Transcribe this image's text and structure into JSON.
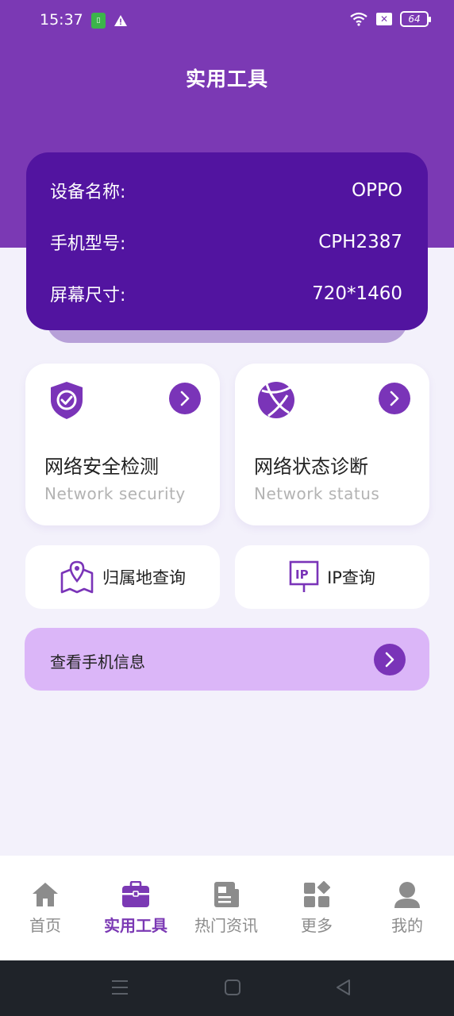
{
  "status_bar": {
    "time": "15:37",
    "battery": "64",
    "icons": [
      "sim-icon",
      "warning-icon",
      "wifi-icon",
      "no-sim-icon",
      "battery-icon"
    ]
  },
  "header": {
    "title": "实用工具"
  },
  "device_info": {
    "rows": [
      {
        "label": "设备名称:",
        "value": "OPPO"
      },
      {
        "label": "手机型号:",
        "value": "CPH2387"
      },
      {
        "label": "屏幕尺寸:",
        "value": "720*1460"
      }
    ]
  },
  "tools": [
    {
      "title": "网络安全检测",
      "subtitle": "Network security",
      "icon": "shield-check-icon"
    },
    {
      "title": "网络状态诊断",
      "subtitle": "Network status",
      "icon": "globe-icon"
    }
  ],
  "quick_tools": [
    {
      "label": "归属地查询",
      "icon": "map-pin-icon"
    },
    {
      "label": "IP查询",
      "icon": "ip-icon"
    }
  ],
  "phone_info": {
    "label": "查看手机信息"
  },
  "bottom_nav": {
    "items": [
      {
        "label": "首页",
        "icon": "home-icon",
        "active": false
      },
      {
        "label": "实用工具",
        "icon": "toolbox-icon",
        "active": true
      },
      {
        "label": "热门资讯",
        "icon": "news-icon",
        "active": false
      },
      {
        "label": "更多",
        "icon": "grid-icon",
        "active": false
      },
      {
        "label": "我的",
        "icon": "user-icon",
        "active": false
      }
    ]
  },
  "colors": {
    "primary": "#7b39b4",
    "device_card": "#5214a0",
    "info_bar": "#dbb6f8",
    "background": "#f3f1fb"
  }
}
